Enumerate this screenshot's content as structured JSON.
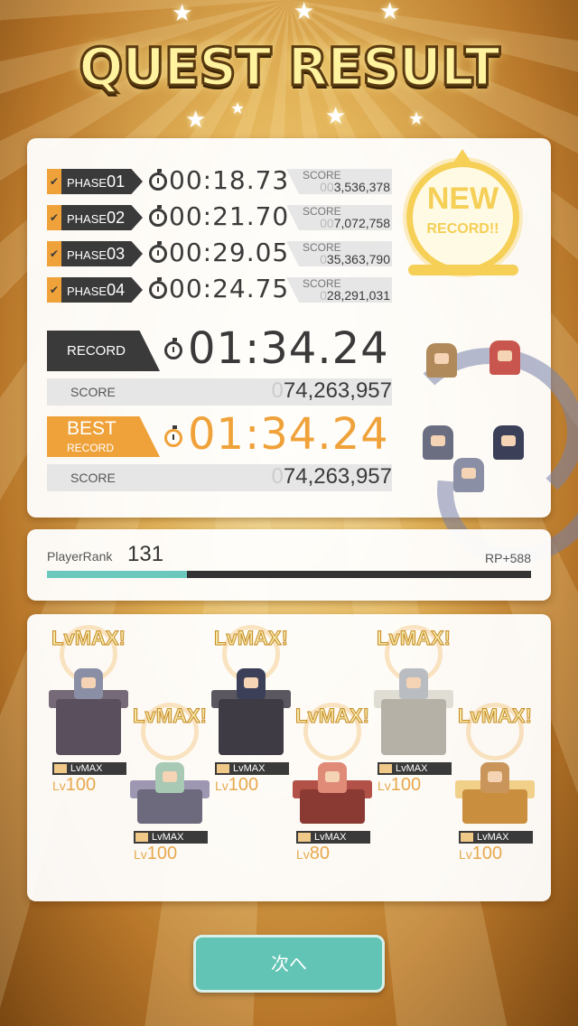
{
  "header": {
    "title": "QUEST RESULT"
  },
  "phases": [
    {
      "label": "PHASE",
      "num": "01",
      "time": "00:18.73",
      "score_label": "SCORE",
      "score_zero": "00",
      "score": "3,536,378"
    },
    {
      "label": "PHASE",
      "num": "02",
      "time": "00:21.70",
      "score_label": "SCORE",
      "score_zero": "00",
      "score": "7,072,758"
    },
    {
      "label": "PHASE",
      "num": "03",
      "time": "00:29.05",
      "score_label": "SCORE",
      "score_zero": "0",
      "score": "35,363,790"
    },
    {
      "label": "PHASE",
      "num": "04",
      "time": "00:24.75",
      "score_label": "SCORE",
      "score_zero": "0",
      "score": "28,291,031"
    }
  ],
  "record": {
    "label": "RECORD",
    "time": "01:34.24",
    "score_label": "SCORE",
    "score_zero": "0",
    "score": "74,263,957"
  },
  "best": {
    "label_top": "BEST",
    "label_bottom": "RECORD",
    "time": "01:34.24",
    "score_label": "SCORE",
    "score_zero": "0",
    "score": "74,263,957"
  },
  "new_record": {
    "line1": "NEW",
    "line2": "RECORD!!"
  },
  "player": {
    "rank_label": "PlayerRank",
    "rank": "131",
    "rp": "RP+588",
    "progress": 0.29
  },
  "units": [
    {
      "burst": "LvMAX!",
      "tag": "LvMAX",
      "lv_prefix": "Lv",
      "lv": "100",
      "ped_color": "#5a4f5c",
      "ped_top": "#766a78",
      "hair": "#8a8fa6"
    },
    {
      "burst": "LvMAX!",
      "tag": "LvMAX",
      "lv_prefix": "Lv",
      "lv": "100",
      "ped_color": "#6e6a7e",
      "ped_top": "#9d97b1",
      "hair": "#a8c9b4"
    },
    {
      "burst": "LvMAX!",
      "tag": "LvMAX",
      "lv_prefix": "Lv",
      "lv": "100",
      "ped_color": "#3e3b44",
      "ped_top": "#5b5761",
      "hair": "#3b3f58"
    },
    {
      "burst": "LvMAX!",
      "tag": "LvMAX",
      "lv_prefix": "Lv",
      "lv": "80",
      "ped_color": "#8a3a33",
      "ped_top": "#b25147",
      "hair": "#e08a78"
    },
    {
      "burst": "LvMAX!",
      "tag": "LvMAX",
      "lv_prefix": "Lv",
      "lv": "100",
      "ped_color": "#b6b1a7",
      "ped_top": "#e0ddd4",
      "hair": "#b9bcc0"
    },
    {
      "burst": "LvMAX!",
      "tag": "LvMAX",
      "lv_prefix": "Lv",
      "lv": "100",
      "ped_color": "#c98f3e",
      "ped_top": "#f1d08a",
      "hair": "#c9955a"
    }
  ],
  "next_button": {
    "label": "次へ"
  },
  "colors": {
    "accent": "#f0a23a",
    "teal": "#62c4b4",
    "dark": "#3a3a3a",
    "gold": "#f5cf56"
  }
}
